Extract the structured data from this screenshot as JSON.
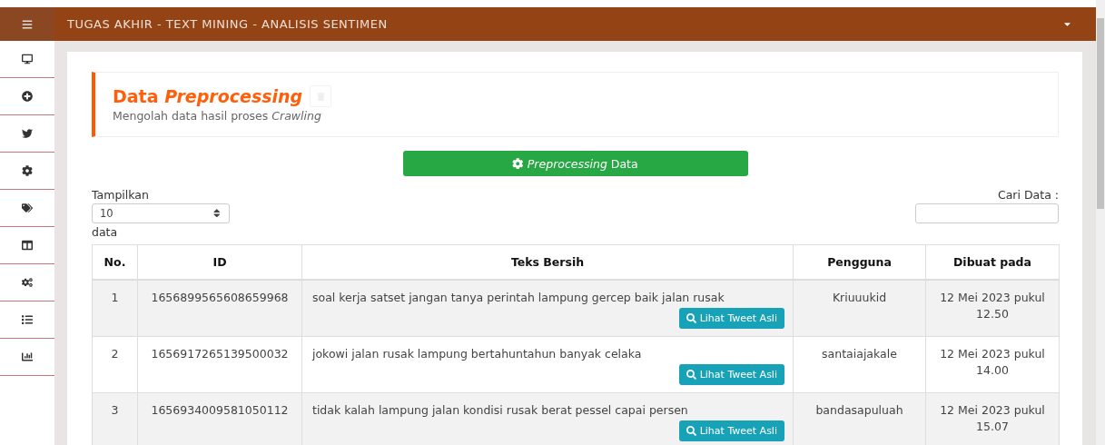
{
  "topbar": {
    "title": "TUGAS AKHIR - TEXT MINING - ANALISIS SENTIMEN"
  },
  "header": {
    "title": "Data *Preprocessing*",
    "subtitle": "Mengolah data hasil proses *Crawling*"
  },
  "action_button": "*Preprocessing* Data",
  "length_control": {
    "label": "Tampilkan",
    "value": "10",
    "suffix": "data"
  },
  "search": {
    "label": "Cari Data :"
  },
  "table": {
    "columns": [
      "No.",
      "ID",
      "Teks Bersih",
      "Pengguna",
      "Dibuat pada"
    ],
    "rows": [
      {
        "no": "1",
        "id": "1656899565608659968",
        "text": "soal kerja satset jangan tanya perintah lampung gercep baik jalan rusak",
        "button": "Lihat Tweet Asli",
        "user": "Kriuuukid",
        "created": "12 Mei 2023 pukul 12.50"
      },
      {
        "no": "2",
        "id": "1656917265139500032",
        "text": "jokowi jalan rusak lampung bertahuntahun banyak celaka",
        "button": "Lihat Tweet Asli",
        "user": "santaiajakale",
        "created": "12 Mei 2023 pukul 14.00"
      },
      {
        "no": "3",
        "id": "1656934009581050112",
        "text": "tidak kalah lampung jalan kondisi rusak berat pessel capai persen",
        "button": "Lihat Tweet Asli",
        "user": "bandasapuluah",
        "created": "12 Mei 2023 pukul 15.07"
      }
    ]
  }
}
